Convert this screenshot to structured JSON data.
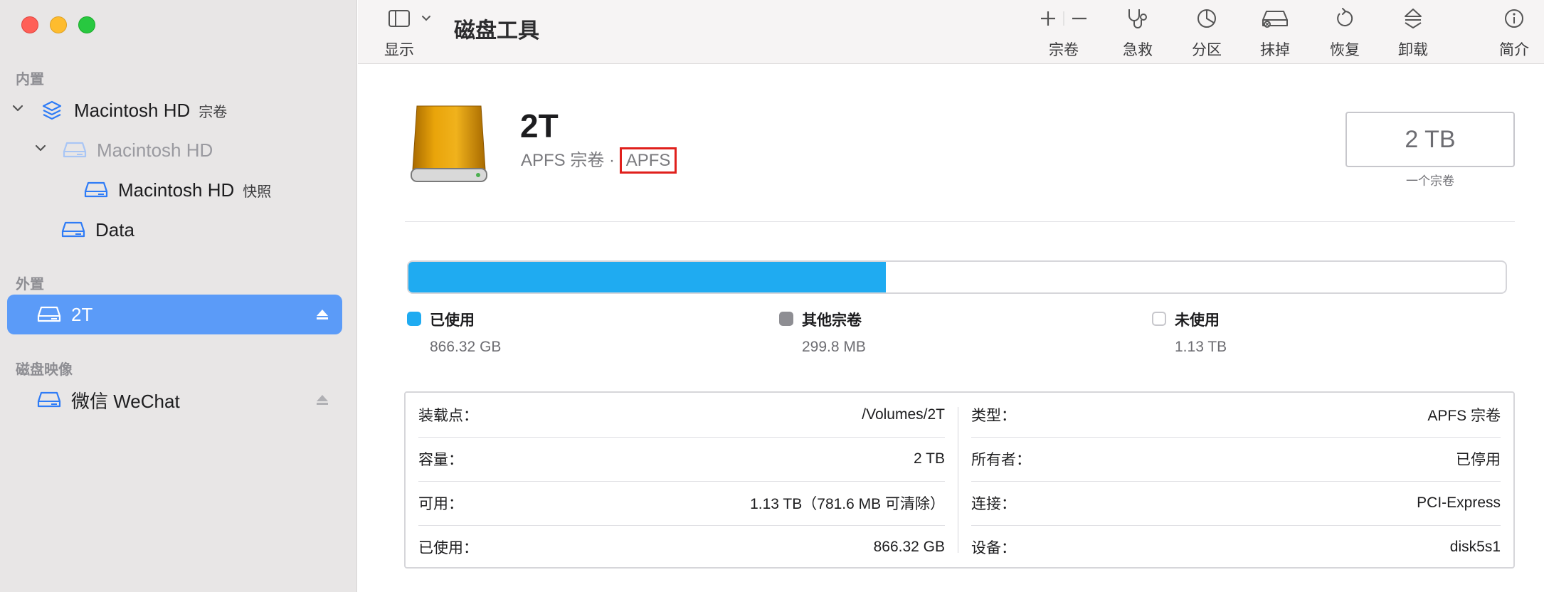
{
  "app": {
    "title": "磁盘工具"
  },
  "toolbar": {
    "view_label": "显示",
    "volume_label": "宗卷",
    "firstaid_label": "急救",
    "partition_label": "分区",
    "erase_label": "抹掉",
    "restore_label": "恢复",
    "unmount_label": "卸载",
    "info_label": "简介"
  },
  "sidebar": {
    "internal_label": "内置",
    "external_label": "外置",
    "images_label": "磁盘映像",
    "items": [
      {
        "name": "Macintosh HD",
        "sub": "宗卷"
      },
      {
        "name": "Macintosh HD",
        "sub": ""
      },
      {
        "name": "Macintosh HD",
        "sub": "快照"
      },
      {
        "name": "Data",
        "sub": ""
      },
      {
        "name": "2T",
        "sub": ""
      },
      {
        "name": "微信 WeChat",
        "sub": ""
      }
    ]
  },
  "volume": {
    "name": "2T",
    "type_prefix": "APFS 宗卷 · ",
    "format": "APFS",
    "size": "2 TB",
    "size_caption": "一个宗卷"
  },
  "usage": {
    "used_fraction": 0.435,
    "used_color": "#1fabf1",
    "other_color": "#8e8e93",
    "legend": [
      {
        "label": "已使用",
        "value": "866.32 GB"
      },
      {
        "label": "其他宗卷",
        "value": "299.8 MB"
      },
      {
        "label": "未使用",
        "value": "1.13 TB"
      }
    ]
  },
  "info": {
    "left": [
      {
        "key": "装载点：",
        "value": "/Volumes/2T"
      },
      {
        "key": "容量：",
        "value": "2 TB"
      },
      {
        "key": "可用：",
        "value": "1.13 TB（781.6 MB 可清除）"
      },
      {
        "key": "已使用：",
        "value": "866.32 GB"
      }
    ],
    "right": [
      {
        "key": "类型：",
        "value": "APFS 宗卷"
      },
      {
        "key": "所有者：",
        "value": "已停用"
      },
      {
        "key": "连接：",
        "value": "PCI-Express"
      },
      {
        "key": "设备：",
        "value": "disk5s1"
      }
    ]
  },
  "icons": {
    "sidebar_toggle": "sidebar-icon",
    "stack": "stack-icon",
    "disk": "disk-icon",
    "eject": "eject-icon",
    "plus": "plus-icon",
    "minus": "minus-icon",
    "stethoscope": "stethoscope-icon",
    "pie": "pie-icon",
    "erase": "erase-icon",
    "restore": "restore-icon",
    "unmount": "unmount-icon",
    "info": "info-icon"
  }
}
